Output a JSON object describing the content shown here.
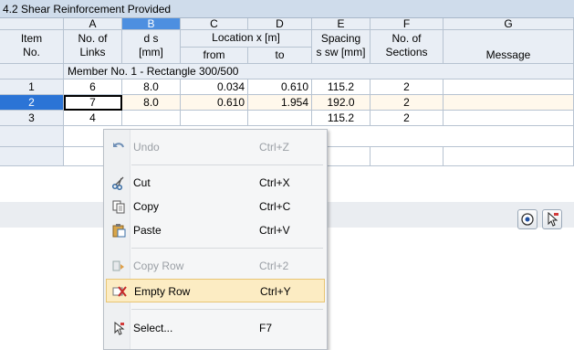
{
  "title": "4.2 Shear Reinforcement Provided",
  "columns": {
    "letters": [
      "A",
      "B",
      "C",
      "D",
      "E",
      "F",
      "G"
    ],
    "item_top": "Item",
    "item_bottom": "No.",
    "a_top": "No. of",
    "a_bottom": "Links",
    "b_top": "d s",
    "b_bottom": "[mm]",
    "cd_top": "Location x [m]",
    "c_bottom": "from",
    "d_bottom": "to",
    "e_top": "Spacing",
    "e_bottom": "s sw [mm]",
    "f_top": "No. of",
    "f_bottom": "Sections",
    "g_bottom": "Message"
  },
  "group_label": "Member No. 1 - Rectangle 300/500",
  "rows": [
    {
      "item": "1",
      "links": "6",
      "ds": "8.0",
      "from": "0.034",
      "to": "0.610",
      "spacing": "115.2",
      "sections": "2",
      "message": ""
    },
    {
      "item": "2",
      "links": "7",
      "ds": "8.0",
      "from": "0.610",
      "to": "1.954",
      "spacing": "192.0",
      "sections": "2",
      "message": ""
    },
    {
      "item": "3",
      "links": "4",
      "ds": "",
      "from": "",
      "to": "",
      "spacing": "115.2",
      "sections": "2",
      "message": ""
    }
  ],
  "context_menu": [
    {
      "label": "Undo",
      "shortcut": "Ctrl+Z",
      "icon": "undo-icon",
      "enabled": false
    },
    {
      "label": "Cut",
      "shortcut": "Ctrl+X",
      "icon": "scissors-icon",
      "enabled": true
    },
    {
      "label": "Copy",
      "shortcut": "Ctrl+C",
      "icon": "copy-icon",
      "enabled": true
    },
    {
      "label": "Paste",
      "shortcut": "Ctrl+V",
      "icon": "paste-icon",
      "enabled": true
    },
    {
      "label": "Copy Row",
      "shortcut": "Ctrl+2",
      "icon": "copy-row-icon",
      "enabled": false
    },
    {
      "label": "Empty Row",
      "shortcut": "Ctrl+Y",
      "icon": "empty-row-icon",
      "enabled": true,
      "highlighted": true
    },
    {
      "label": "Select...",
      "shortcut": "F7",
      "icon": "select-icon",
      "enabled": true
    }
  ],
  "colors": {
    "header_bg": "#e9eef5",
    "selected_column": "#4d8fe0",
    "selected_row": "#2b74d6",
    "menu_highlight": "#fcecc3"
  }
}
